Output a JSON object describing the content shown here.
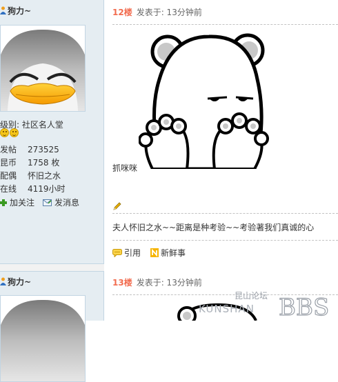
{
  "post1": {
    "author": "狗力~",
    "level_label": "级别: 社区名人堂",
    "stats": [
      {
        "label": "发帖",
        "value": "273525"
      },
      {
        "label": "昆币",
        "value": "1758 枚"
      },
      {
        "label": "配偶",
        "value": "怀旧之水"
      },
      {
        "label": "在线",
        "value": "4119小时"
      }
    ],
    "follow_label": "加关注",
    "message_label": "发消息",
    "floor": "12楼",
    "posted": "发表于: 13分钟前",
    "image_caption": "抓咪咪",
    "signature": "夫人怀旧之水~~距离是种考验~~考验著我们真诚的心",
    "quote_label": "引用",
    "news_label": "新鲜事"
  },
  "post2": {
    "author": "狗力~",
    "floor": "13楼",
    "posted": "发表于: 13分钟前"
  },
  "watermark": {
    "cn": "昆山论坛",
    "en": "KUNSHAN",
    "bbs": "BBS"
  },
  "colors": {
    "floor": "#f26c4f",
    "sidebar_bg": "#e5edf2",
    "border": "#c2d5e3"
  }
}
